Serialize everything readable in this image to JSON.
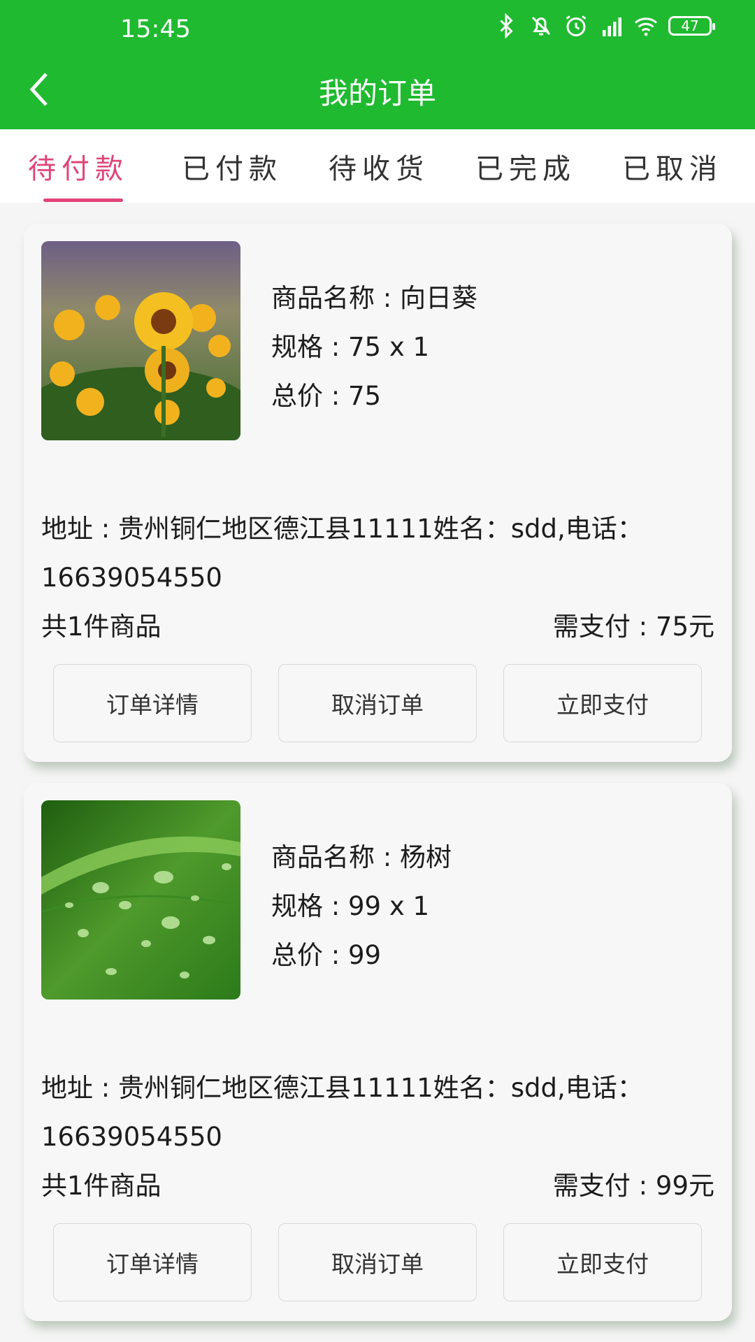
{
  "status_bar": {
    "time": "15:45",
    "battery": "47",
    "icons": [
      "bluetooth-icon",
      "bell-off-icon",
      "alarm-icon",
      "hd-signal-icon",
      "wifi-icon",
      "battery-icon"
    ]
  },
  "header": {
    "title": "我的订单",
    "back_icon": "chevron-left-icon",
    "color": "#1fba2f"
  },
  "tabs": [
    {
      "label": "待付款",
      "active": true
    },
    {
      "label": "已付款",
      "active": false
    },
    {
      "label": "待收货",
      "active": false
    },
    {
      "label": "已完成",
      "active": false
    },
    {
      "label": "已取消",
      "active": false
    }
  ],
  "accent_color": "#e0457a",
  "orders": [
    {
      "image": "sunflower-photo",
      "name": "商品名称 : 向日葵",
      "spec": "规格 : 75 x 1",
      "total": "总价 : 75",
      "address": "地址 : 贵州铜仁地区德江县11111姓名：sdd,电话：16639054550",
      "count": "共1件商品",
      "pay": "需支付 : 75元",
      "buttons": {
        "detail": "订单详情",
        "cancel": "取消订单",
        "pay": "立即支付"
      }
    },
    {
      "image": "leaf-waterdrop-photo",
      "name": "商品名称 : 杨树",
      "spec": "规格 : 99 x 1",
      "total": "总价 : 99",
      "address": "地址 : 贵州铜仁地区德江县11111姓名：sdd,电话：16639054550",
      "count": "共1件商品",
      "pay": "需支付 : 99元",
      "buttons": {
        "detail": "订单详情",
        "cancel": "取消订单",
        "pay": "立即支付"
      }
    }
  ]
}
